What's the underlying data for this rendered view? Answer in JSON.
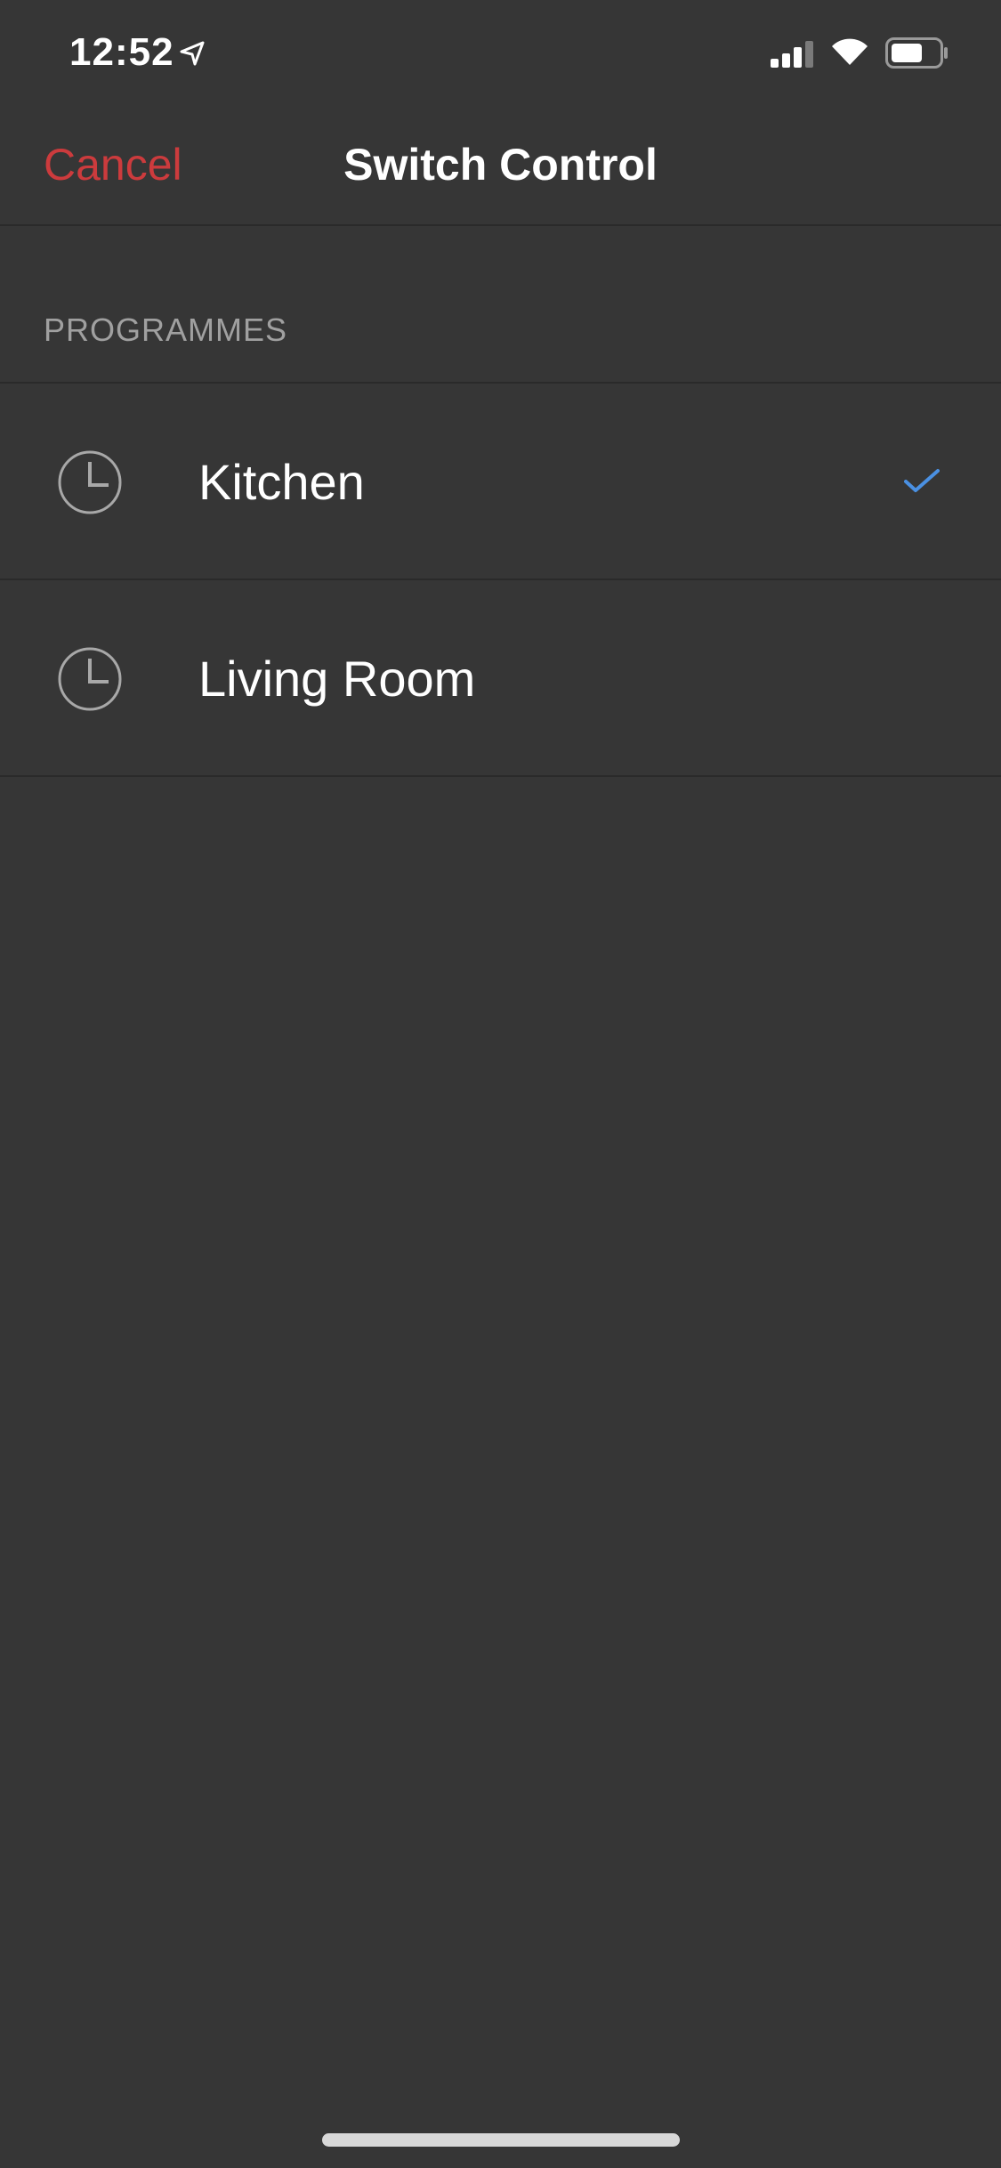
{
  "status_bar": {
    "time": "12:52",
    "location_icon": "location-arrow-icon",
    "signal_icon": "cellular-signal-icon",
    "wifi_icon": "wifi-icon",
    "battery_icon": "battery-icon"
  },
  "nav": {
    "cancel_label": "Cancel",
    "title": "Switch Control"
  },
  "section": {
    "header": "PROGRAMMES"
  },
  "programmes": [
    {
      "label": "Kitchen",
      "icon": "clock-icon",
      "selected": true
    },
    {
      "label": "Living Room",
      "icon": "clock-icon",
      "selected": false
    }
  ],
  "colors": {
    "background": "#363636",
    "cancel": "#cc3b3d",
    "checkmark": "#4a90e2",
    "separator": "#2a2a2a"
  }
}
